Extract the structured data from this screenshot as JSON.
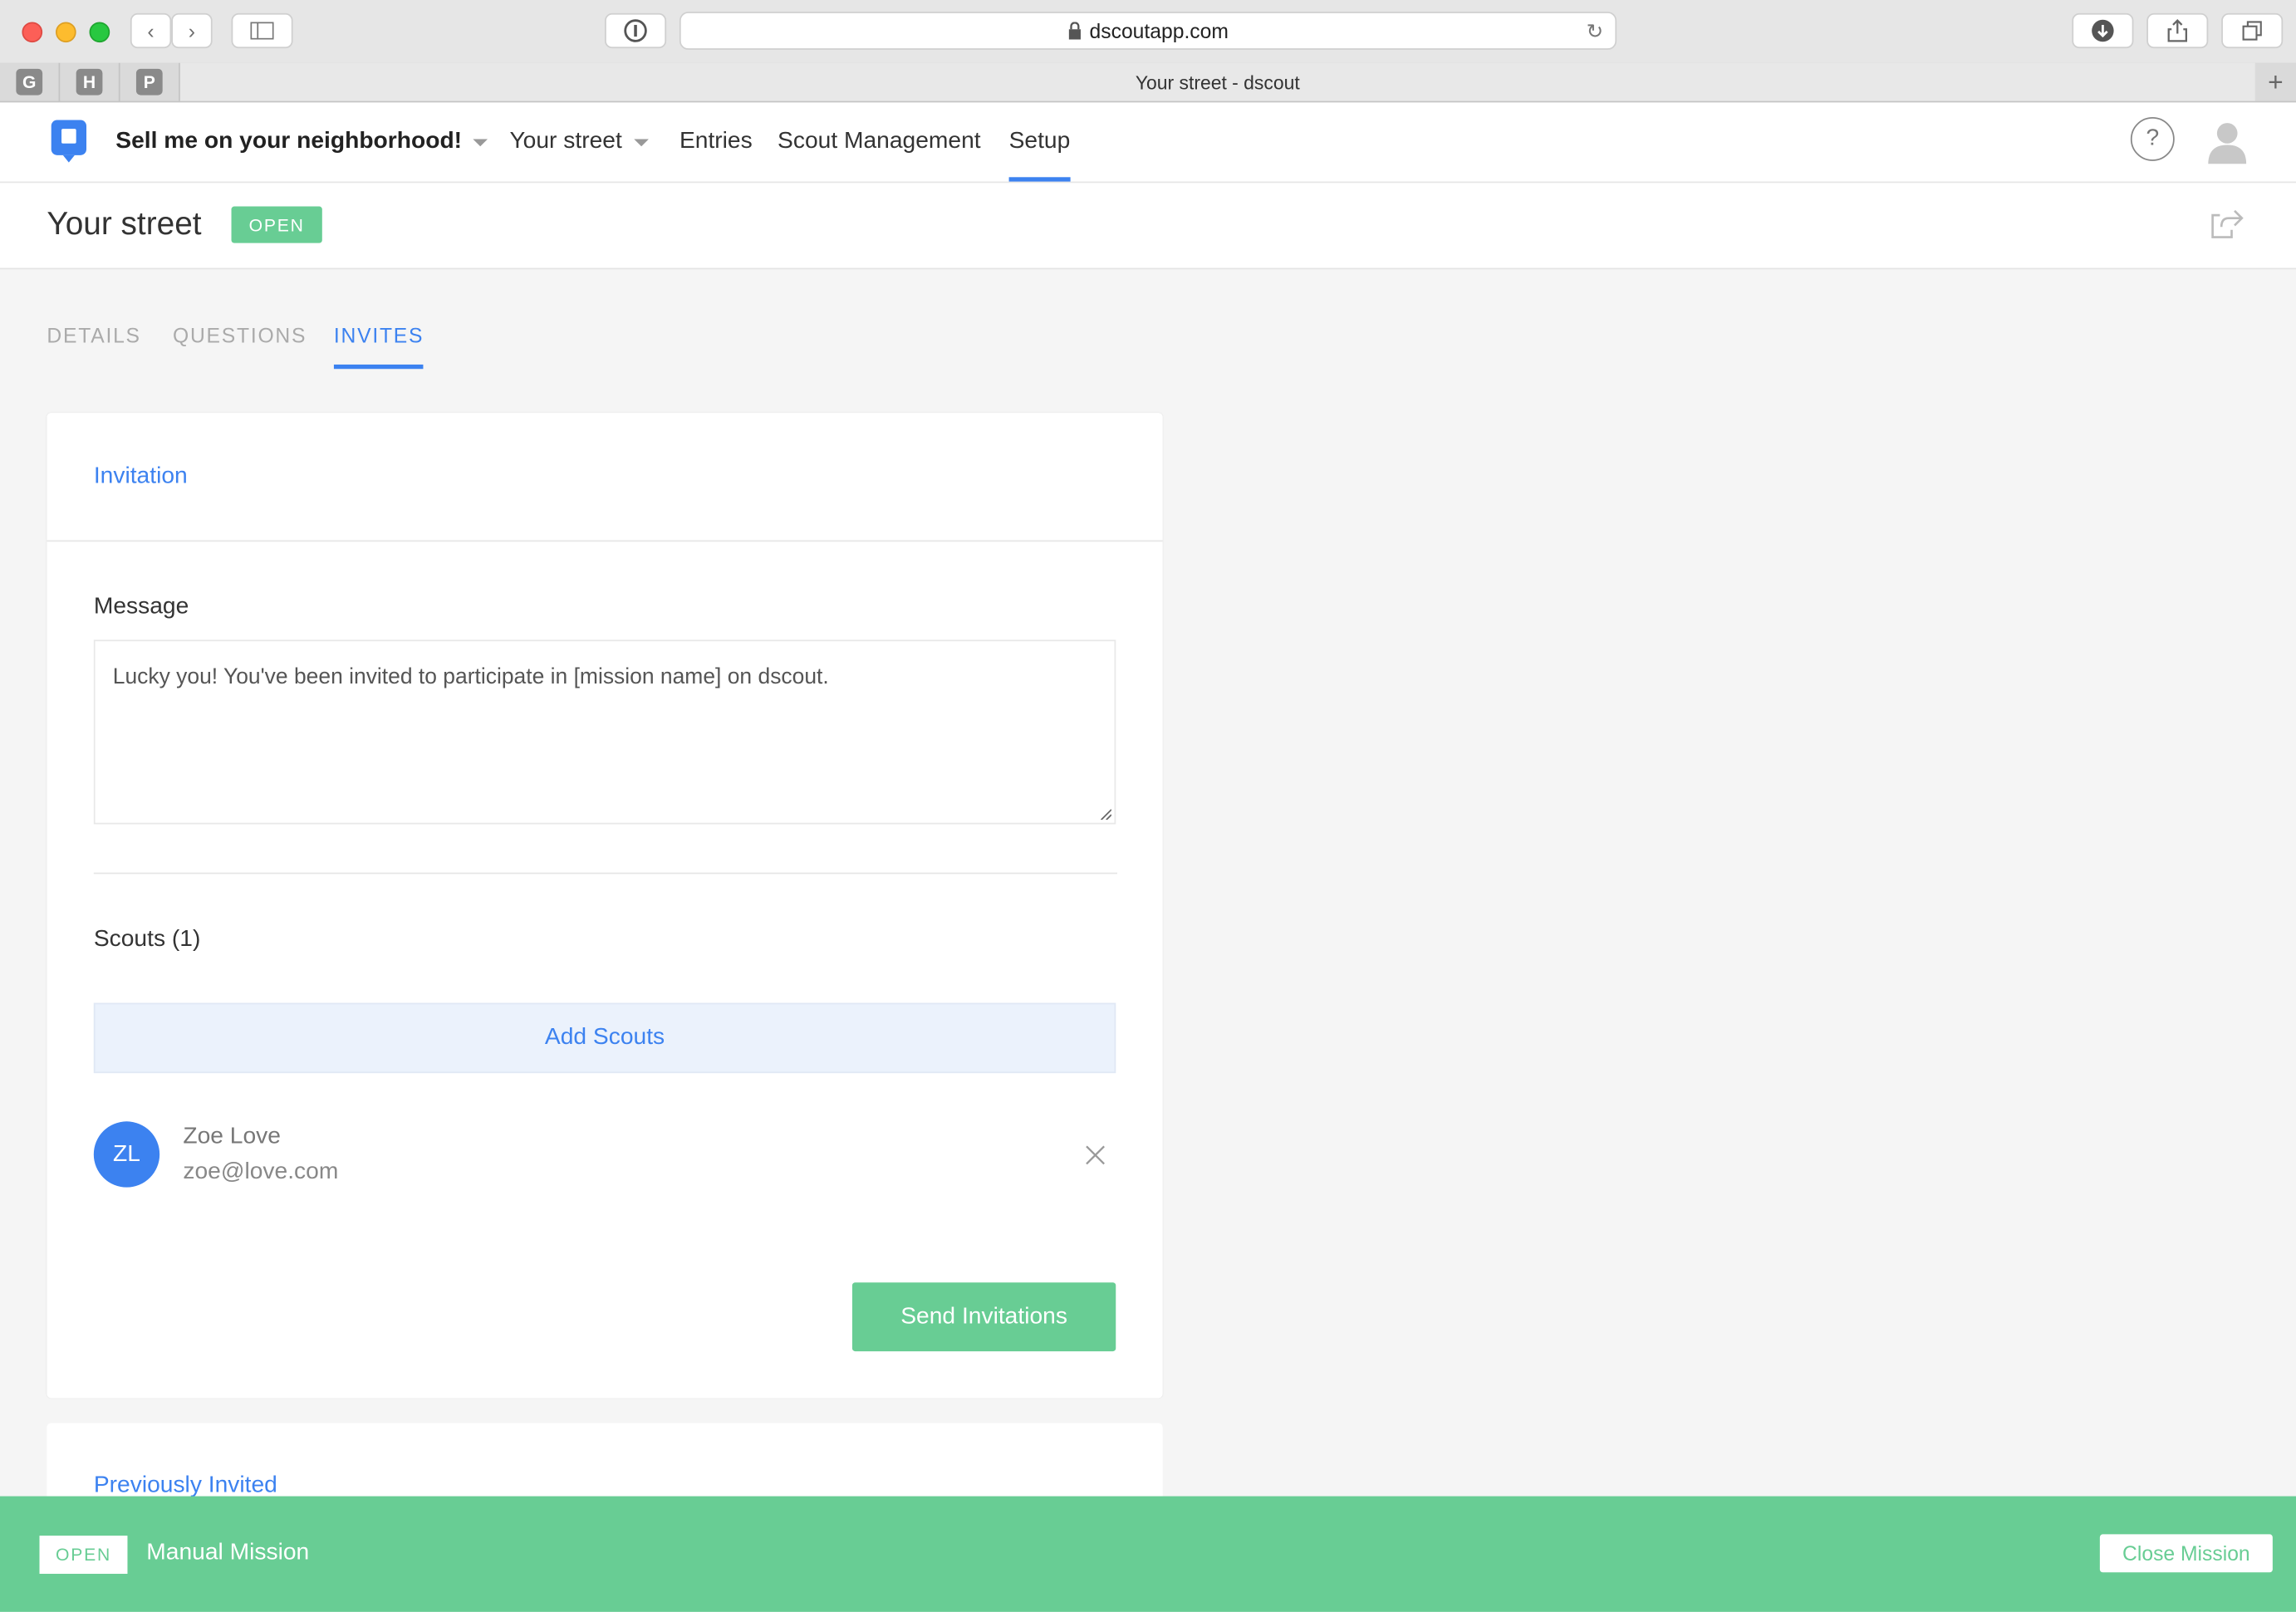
{
  "browser": {
    "url": "dscoutapp.com",
    "tab_title": "Your street - dscout",
    "pinned_tabs": [
      "G",
      "H",
      "P"
    ]
  },
  "nav": {
    "mission": "Sell me on your neighborhood!",
    "part": "Your street",
    "entries": "Entries",
    "scout_management": "Scout Management",
    "setup": "Setup",
    "help": "?"
  },
  "page": {
    "title": "Your street",
    "status": "OPEN"
  },
  "tabs": [
    "DETAILS",
    "QUESTIONS",
    "INVITES"
  ],
  "invitation": {
    "heading": "Invitation",
    "message_label": "Message",
    "message_value": "Lucky you! You've been invited to participate in [mission name] on dscout.",
    "scouts_label": "Scouts (1)",
    "add_scouts": "Add Scouts",
    "scouts": [
      {
        "initials": "ZL",
        "name": "Zoe Love",
        "email": "zoe@love.com"
      }
    ],
    "send_button": "Send Invitations"
  },
  "previously_invited": {
    "heading": "Previously Invited"
  },
  "footer": {
    "status": "OPEN",
    "mission_type": "Manual Mission",
    "close_button": "Close Mission"
  },
  "colors": {
    "accent": "#3c82f0",
    "success": "#68cd94"
  }
}
